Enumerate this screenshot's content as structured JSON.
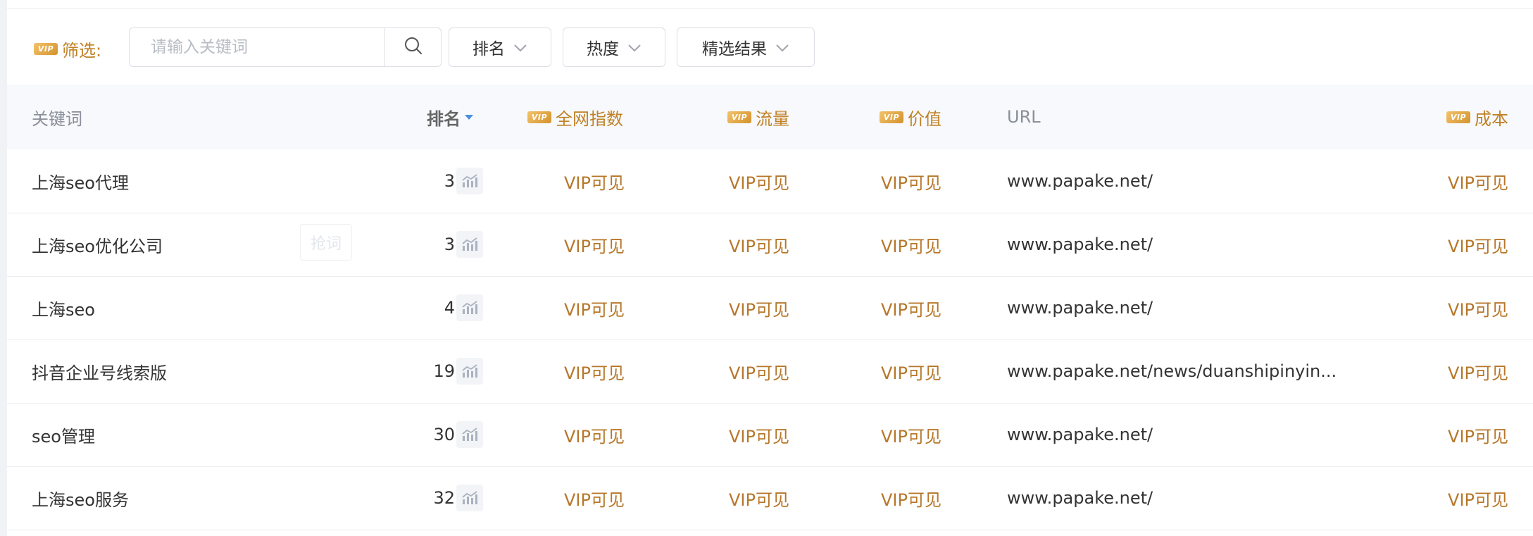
{
  "filter": {
    "vip_badge": "VIP",
    "label": "筛选:",
    "search_placeholder": "请输入关键词",
    "dropdowns": [
      "排名",
      "热度",
      "精选结果"
    ]
  },
  "table": {
    "headers": {
      "keyword": "关键词",
      "rank": "排名",
      "index": "全网指数",
      "traffic": "流量",
      "value": "价值",
      "url": "URL",
      "cost": "成本"
    },
    "ghost_tag": "抢词",
    "rows": [
      {
        "keyword": "上海seo代理",
        "rank": "3",
        "index": "VIP可见",
        "traffic": "VIP可见",
        "value": "VIP可见",
        "url": "www.papake.net/",
        "cost": "VIP可见"
      },
      {
        "keyword": "上海seo优化公司",
        "rank": "3",
        "index": "VIP可见",
        "traffic": "VIP可见",
        "value": "VIP可见",
        "url": "www.papake.net/",
        "cost": "VIP可见"
      },
      {
        "keyword": "上海seo",
        "rank": "4",
        "index": "VIP可见",
        "traffic": "VIP可见",
        "value": "VIP可见",
        "url": "www.papake.net/",
        "cost": "VIP可见"
      },
      {
        "keyword": "抖音企业号线索版",
        "rank": "19",
        "index": "VIP可见",
        "traffic": "VIP可见",
        "value": "VIP可见",
        "url": "www.papake.net/news/duanshipinyin...",
        "cost": "VIP可见"
      },
      {
        "keyword": "seo管理",
        "rank": "30",
        "index": "VIP可见",
        "traffic": "VIP可见",
        "value": "VIP可见",
        "url": "www.papake.net/",
        "cost": "VIP可见"
      },
      {
        "keyword": "上海seo服务",
        "rank": "32",
        "index": "VIP可见",
        "traffic": "VIP可见",
        "value": "VIP可见",
        "url": "www.papake.net/",
        "cost": "VIP可见"
      }
    ]
  },
  "colors": {
    "vip_gold": "#c08126",
    "sort_arrow": "#4a90e2",
    "header_bg": "#f7f9fc"
  }
}
